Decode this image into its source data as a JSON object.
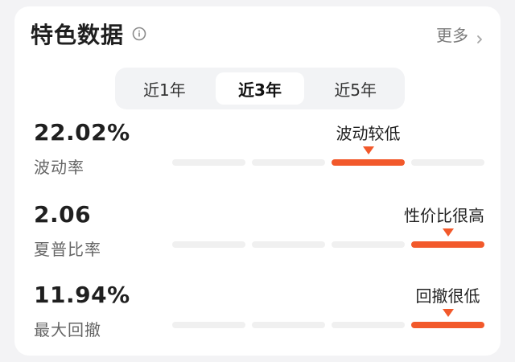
{
  "card": {
    "title": "特色数据",
    "more_label": "更多"
  },
  "tabs": [
    {
      "label": "近1年",
      "active": false
    },
    {
      "label": "近3年",
      "active": true
    },
    {
      "label": "近5年",
      "active": false
    }
  ],
  "metrics": [
    {
      "value": "22.02%",
      "name": "波动率",
      "level_text": "波动较低",
      "level_index": 2,
      "segments": 4
    },
    {
      "value": "2.06",
      "name": "夏普比率",
      "level_text": "性价比很高",
      "level_index": 3,
      "segments": 4
    },
    {
      "value": "11.94%",
      "name": "最大回撤",
      "level_text": "回撤很低",
      "level_index": 3,
      "segments": 4
    }
  ],
  "colors": {
    "accent": "#f2592b",
    "track": "#f0f0f0"
  },
  "icons": {
    "info": "info-circle-icon",
    "chevron": "chevron-right-icon"
  }
}
